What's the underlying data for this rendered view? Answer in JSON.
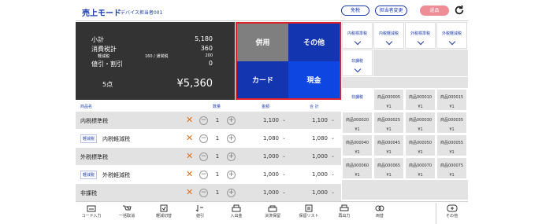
{
  "header": {
    "mode": "売上モード",
    "staff": "デバイス担当者001",
    "tax_button": "免税",
    "staff_change_button": "担当者変更",
    "refund_button": "返品",
    "accent": "#1a3cad"
  },
  "totals": {
    "subtotal_label": "小計",
    "subtotal_value": "5,180",
    "tax_label": "消費税計",
    "tax_value": "360",
    "reduced_label": "軽減税",
    "reduced_detail": "160 / 通常税",
    "reduced_value": "200",
    "discount_label": "値引・割引",
    "discount_value": "0",
    "count": "5点",
    "grand_total": "¥5,360"
  },
  "payment": {
    "multi": "併用",
    "other": "その他",
    "card": "カード",
    "cash": "現金"
  },
  "list_headers": {
    "name": "商品名",
    "qty": "数量",
    "price": "金額",
    "total": "合 計"
  },
  "items": [
    {
      "badge": "",
      "name": "内税標準税",
      "qty": "1",
      "price": "1,100",
      "total": "1,100"
    },
    {
      "badge": "軽減税",
      "name": "内税軽減税",
      "qty": "1",
      "price": "1,080",
      "total": "1,080"
    },
    {
      "badge": "",
      "name": "外税標準税",
      "qty": "1",
      "price": "1,000",
      "total": "1,000"
    },
    {
      "badge": "軽減税",
      "name": "外税軽減税",
      "qty": "1",
      "price": "1,000",
      "total": "1,000"
    },
    {
      "badge": "",
      "name": "非課税",
      "qty": "1",
      "price": "1,000",
      "total": "1,000"
    }
  ],
  "categories": [
    "内税標準税",
    "内税軽減税",
    "外税標準税",
    "外税軽減税",
    "非課税"
  ],
  "products": [
    {
      "name": "非課税",
      "price": ""
    },
    {
      "name": "商品000005",
      "price": "¥1"
    },
    {
      "name": "商品000010",
      "price": "¥1"
    },
    {
      "name": "商品000015",
      "price": "¥1"
    },
    {
      "name": "商品000020",
      "price": "¥1"
    },
    {
      "name": "商品000025",
      "price": "¥1"
    },
    {
      "name": "商品000030",
      "price": "¥1"
    },
    {
      "name": "商品000035",
      "price": "¥1"
    },
    {
      "name": "商品000040",
      "price": "¥1"
    },
    {
      "name": "商品000045",
      "price": "¥1"
    },
    {
      "name": "商品000050",
      "price": "¥1"
    },
    {
      "name": "商品000055",
      "price": "¥1"
    },
    {
      "name": "商品000060",
      "price": "¥1"
    },
    {
      "name": "商品000065",
      "price": "¥1"
    },
    {
      "name": "商品000070",
      "price": "¥1"
    },
    {
      "name": "商品000075",
      "price": "¥1"
    }
  ],
  "toolbar": [
    {
      "label": "コード入力",
      "icon": "keyboard-icon"
    },
    {
      "label": "一括取消",
      "icon": "cart-cancel-icon"
    },
    {
      "label": "軽減切替",
      "icon": "tax-switch-icon"
    },
    {
      "label": "値引",
      "icon": "discount-icon"
    },
    {
      "label": "入出金",
      "icon": "register-icon"
    },
    {
      "label": "決済保留",
      "icon": "hold-icon"
    },
    {
      "label": "保留リスト",
      "icon": "hold-list-icon"
    },
    {
      "label": "再出力",
      "icon": "printer-icon"
    },
    {
      "label": "両替",
      "icon": "exchange-icon"
    },
    {
      "label": "その他",
      "icon": "more-icon"
    }
  ]
}
